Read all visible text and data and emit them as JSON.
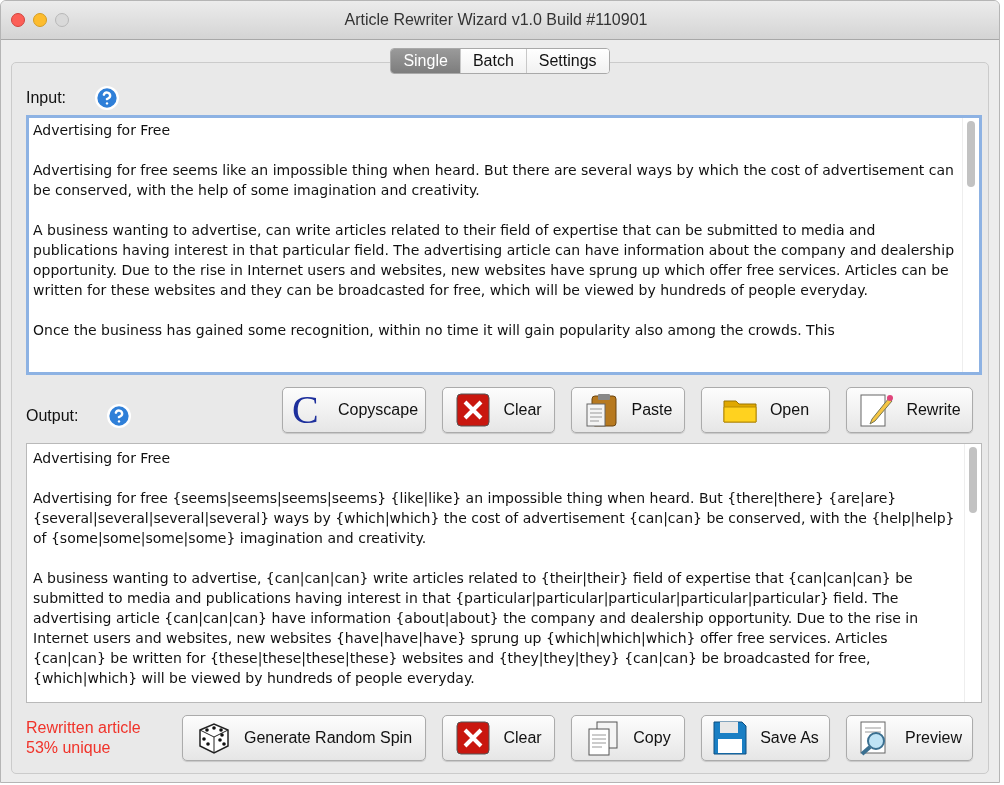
{
  "window": {
    "title": "Article Rewriter Wizard v1.0 Build #110901"
  },
  "tabs": [
    {
      "label": "Single",
      "selected": true
    },
    {
      "label": "Batch",
      "selected": false
    },
    {
      "label": "Settings",
      "selected": false
    }
  ],
  "input": {
    "label": "Input:",
    "paragraphs": [
      "Advertising for Free",
      "Advertising for free seems like an impossible thing when heard. But there are several ways by which the cost of advertisement can be conserved, with the help of some imagination and creativity.",
      "A business wanting to advertise, can write articles related to their field of expertise that can be submitted to media and publications having interest in that particular field. The advertising article can have information about the company and dealership opportunity. Due to the rise in Internet users and websites, new websites have sprung up which offer free services. Articles can be written for these websites and they can be broadcasted for free, which will be viewed by hundreds of people everyday.",
      "Once the business has gained some recognition, within no time it will gain popularity also among the crowds. This"
    ]
  },
  "input_buttons": [
    {
      "kind": "copyscape",
      "label": "Copyscape",
      "logo_text": "C"
    },
    {
      "kind": "clear",
      "label": "Clear"
    },
    {
      "kind": "paste",
      "label": "Paste"
    },
    {
      "kind": "open",
      "label": "Open"
    },
    {
      "kind": "rewrite",
      "label": "Rewrite"
    }
  ],
  "output": {
    "label": "Output:",
    "paragraphs": [
      "Advertising for Free",
      "Advertising for free {seems|seems|seems|seems} {like|like} an impossible thing when heard. But {there|there} {are|are} {several|several|several|several} ways by {which|which} the cost of advertisement {can|can} be conserved, with the {help|help} of {some|some|some|some} imagination and creativity.",
      "A business wanting to advertise, {can|can|can} write articles related to {their|their} field of expertise that {can|can|can} be submitted to media and publications having interest in that {particular|particular|particular|particular|particular} field. The advertising article {can|can|can} have information {about|about} the company and dealership opportunity. Due to the rise in Internet users and websites, new websites {have|have|have} sprung up {which|which|which} offer free services. Articles {can|can} be written for {these|these|these|these} websites and {they|they|they} {can|can} be broadcasted for free, {which|which} will be viewed by hundreds of people everyday."
    ]
  },
  "status": [
    "Rewritten article",
    "53% unique"
  ],
  "output_buttons": [
    {
      "kind": "dice",
      "label": "Generate Random Spin"
    },
    {
      "kind": "clear",
      "label": "Clear"
    },
    {
      "kind": "copy",
      "label": "Copy"
    },
    {
      "kind": "save",
      "label": "Save As"
    },
    {
      "kind": "preview",
      "label": "Preview"
    }
  ]
}
